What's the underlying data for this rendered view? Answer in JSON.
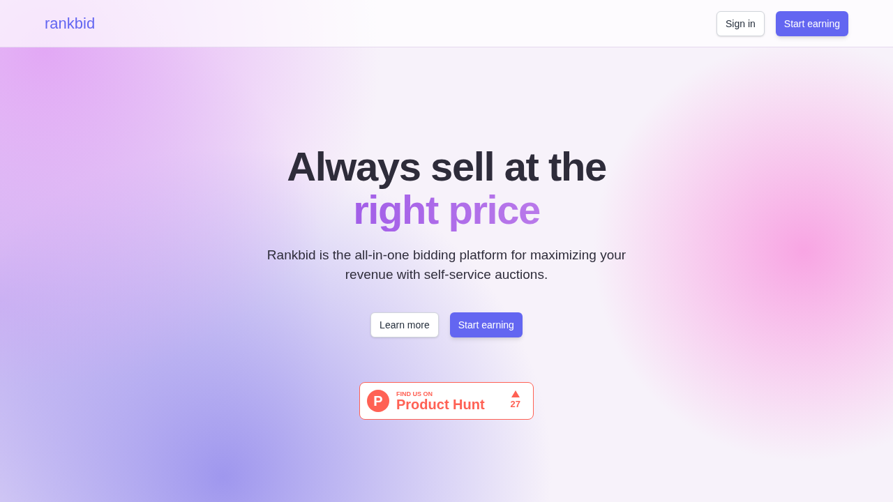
{
  "header": {
    "logo": "rankbid",
    "buttons": [
      {
        "label": "Sign in",
        "kind": "secondary"
      },
      {
        "label": "Start earning",
        "kind": "primary"
      }
    ]
  },
  "hero": {
    "title_line_1": "Always sell at the",
    "title_line_2": "right price",
    "subtitle": "Rankbid is the all-in-one bidding platform for maximizing your revenue with self-service auctions.",
    "buttons": [
      {
        "label": "Learn more",
        "kind": "secondary"
      },
      {
        "label": "Start earning",
        "kind": "primary"
      }
    ]
  },
  "badge": {
    "logo_letter": "P",
    "kicker": "FIND US ON",
    "name": "Product Hunt",
    "upvotes": "27"
  }
}
